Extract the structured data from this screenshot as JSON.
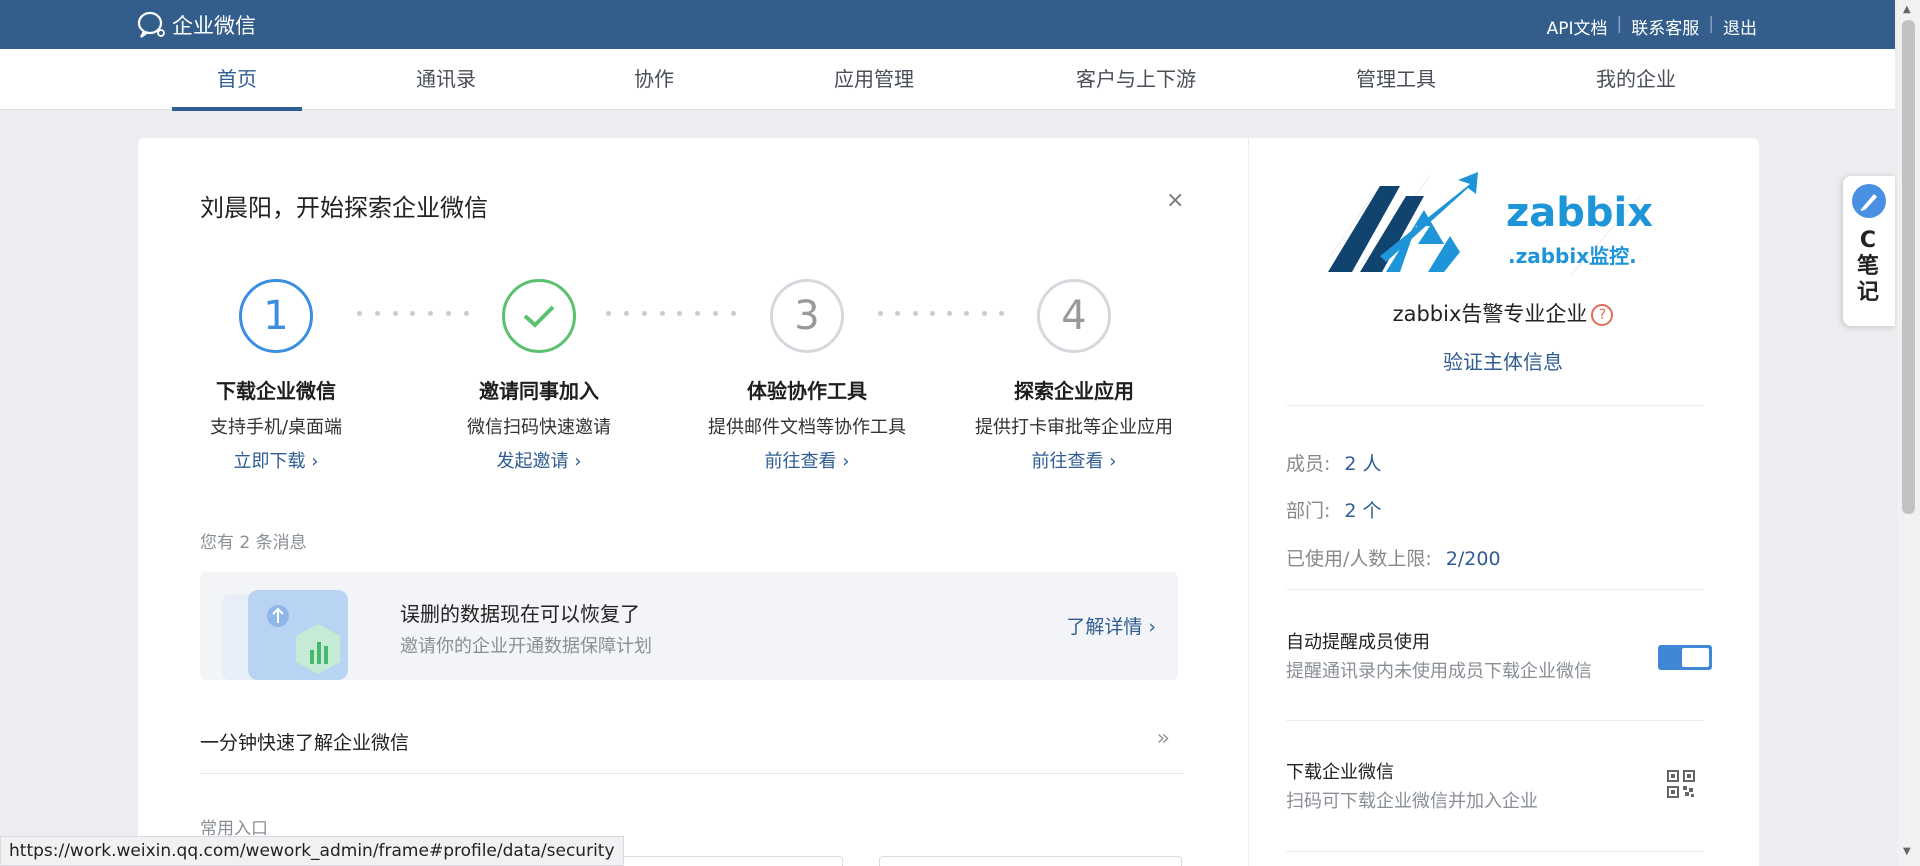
{
  "header": {
    "logo_text": "企业微信",
    "links": [
      "API文档",
      "联系客服",
      "退出"
    ]
  },
  "nav": {
    "items": [
      "首页",
      "通讯录",
      "协作",
      "应用管理",
      "客户与上下游",
      "管理工具",
      "我的企业"
    ],
    "active_index": 0
  },
  "main": {
    "welcome": "刘晨阳，开始探索企业微信",
    "close": "×",
    "steps": [
      {
        "number": "1",
        "title": "下载企业微信",
        "desc": "支持手机/桌面端",
        "link": "立即下载",
        "state": "current"
      },
      {
        "number": "",
        "title": "邀请同事加入",
        "desc": "微信扫码快速邀请",
        "link": "发起邀请",
        "state": "done"
      },
      {
        "number": "3",
        "title": "体验协作工具",
        "desc": "提供邮件文档等协作工具",
        "link": "前往查看",
        "state": "todo"
      },
      {
        "number": "4",
        "title": "探索企业应用",
        "desc": "提供打卡审批等企业应用",
        "link": "前往查看",
        "state": "todo"
      }
    ],
    "message_count": "您有 2 条消息",
    "banner": {
      "title": "误删的数据现在可以恢复了",
      "subtitle": "邀请你的企业开通数据保障计划",
      "link": "了解详情"
    },
    "learn": {
      "text": "一分钟快速了解企业微信",
      "arrow": "»"
    },
    "common_entry": "常用入口"
  },
  "right_panel": {
    "logo_brand": "zabbix",
    "logo_sub": ".zabbix监控.",
    "company_name": "zabbix告警专业企业",
    "help": "?",
    "verify_link": "验证主体信息",
    "stats": [
      {
        "label": "成员:",
        "value": "2 人"
      },
      {
        "label": "部门:",
        "value": "2 个"
      },
      {
        "label": "已使用/人数上限:",
        "value": "2/200"
      }
    ],
    "auto_remind": {
      "title": "自动提醒成员使用",
      "subtitle": "提醒通讯录内未使用成员下载企业微信",
      "enabled": true
    },
    "download": {
      "title": "下载企业微信",
      "subtitle": "扫码可下载企业微信并加入企业"
    }
  },
  "side_widget": {
    "label": "C笔记"
  },
  "status_bar": {
    "url": "https://work.weixin.qq.com/wework_admin/frame#profile/data/security"
  },
  "colors": {
    "header_bg": "#335e8c",
    "accent": "#2f5d93",
    "step_current": "#3c8ee1",
    "step_done": "#5cc16e",
    "toggle_on": "#3f86d6"
  }
}
